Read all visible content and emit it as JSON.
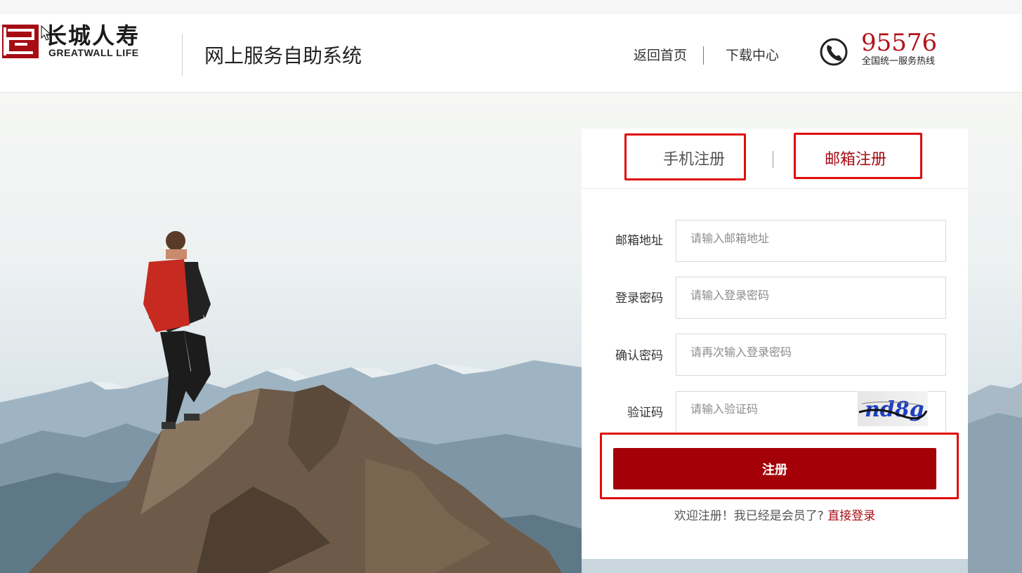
{
  "brand": {
    "name_cn": "长城人寿",
    "name_en": "GREATWALL LIFE",
    "system_title": "网上服务自助系统"
  },
  "nav": {
    "home": "返回首页",
    "download": "下载中心"
  },
  "hotline": {
    "number": "95576",
    "caption": "全国统一服务热线",
    "icon": "phone-icon"
  },
  "tabs": [
    {
      "label": "手机注册",
      "active": false
    },
    {
      "label": "邮箱注册",
      "active": true
    }
  ],
  "form": {
    "email": {
      "label": "邮箱地址",
      "placeholder": "请输入邮箱地址",
      "value": ""
    },
    "password": {
      "label": "登录密码",
      "placeholder": "请输入登录密码",
      "value": ""
    },
    "confirm": {
      "label": "确认密码",
      "placeholder": "请再次输入登录密码",
      "value": ""
    },
    "captcha": {
      "label": "验证码",
      "placeholder": "请输入验证码",
      "value": "",
      "image_text": "nd8g"
    },
    "submit_label": "注册"
  },
  "footer": {
    "text": "欢迎注册！我已经是会员了? ",
    "login_link": "直接登录"
  },
  "colors": {
    "brand_red": "#a60d14",
    "button_red": "#a30008",
    "highlight_box": "#e00c0c"
  }
}
